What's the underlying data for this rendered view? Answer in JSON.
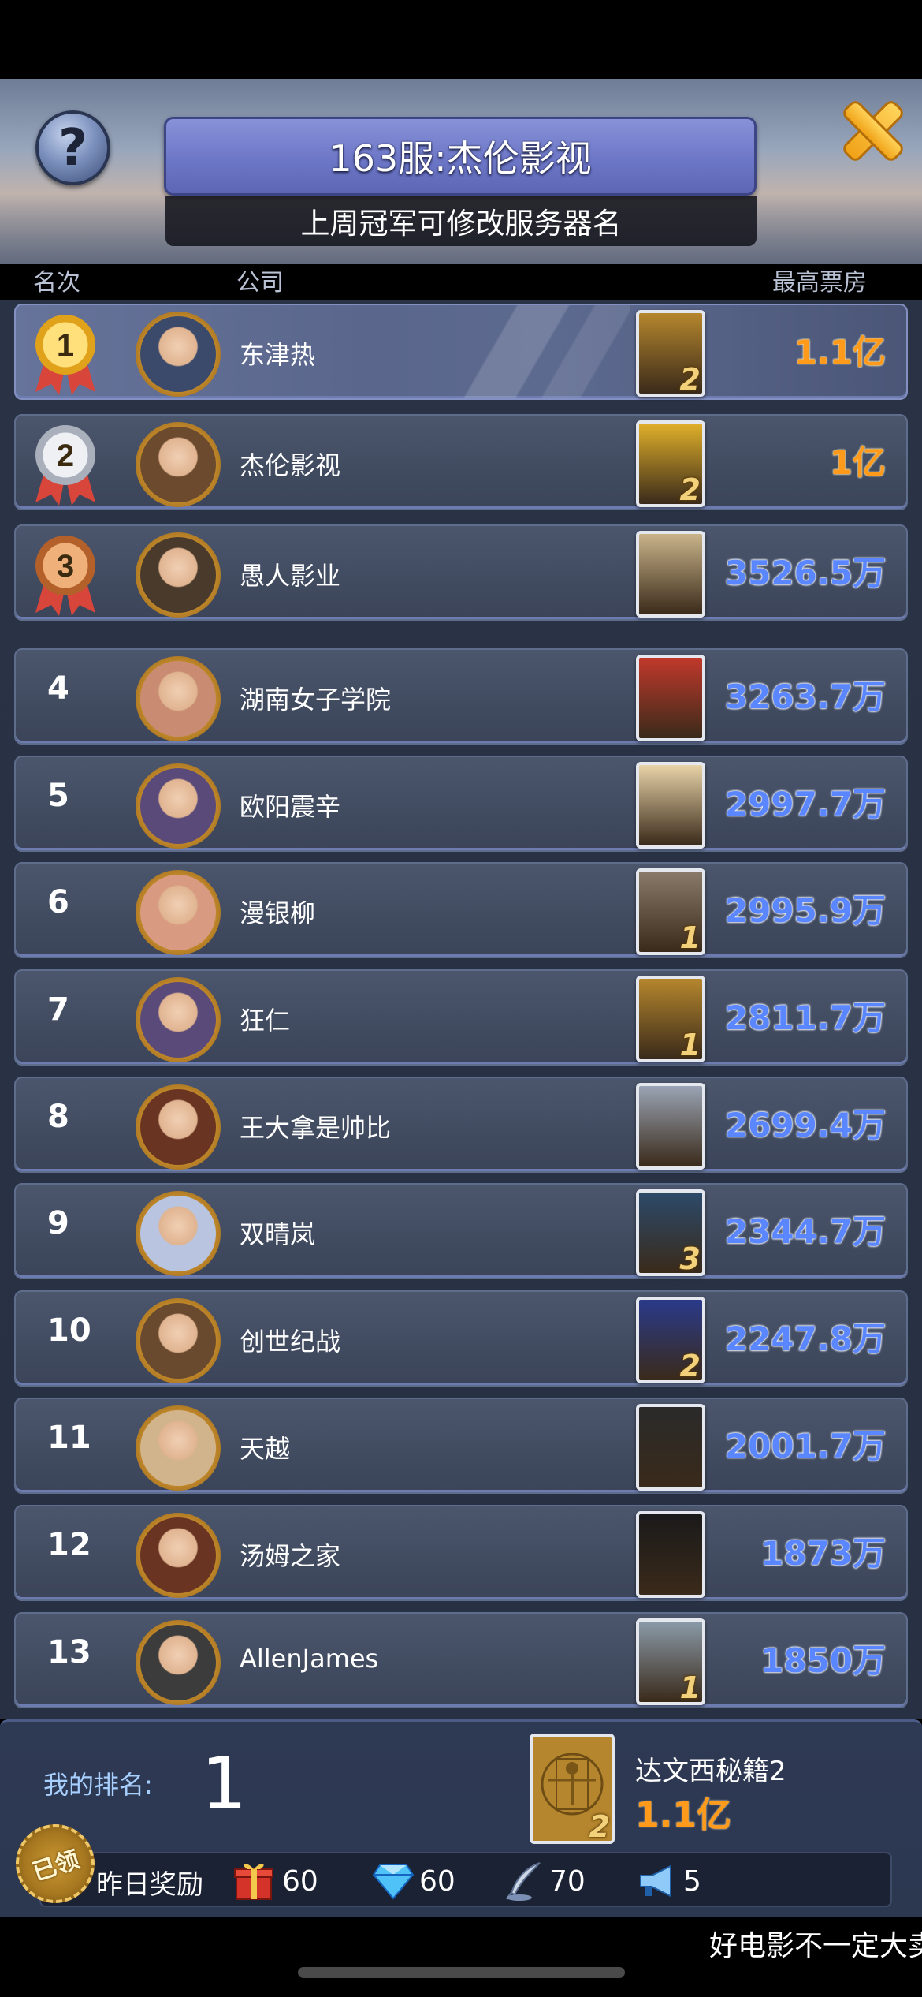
{
  "header": {
    "title": "163服:杰伦影视",
    "subtitle": "上周冠军可修改服务器名"
  },
  "columns": {
    "rank": "名次",
    "company": "公司",
    "top_box_office": "最高票房"
  },
  "rows": [
    {
      "rank": "1",
      "name": "东津热",
      "box_office": "1.1亿",
      "sequel": "2",
      "color": "#ff9a1a"
    },
    {
      "rank": "2",
      "name": "杰伦影视",
      "box_office": "1亿",
      "sequel": "2",
      "color": "#ff9a1a"
    },
    {
      "rank": "3",
      "name": "愚人影业",
      "box_office": "3526.5万",
      "sequel": "",
      "color": "#5a86ff"
    },
    {
      "rank": "4",
      "name": "湖南女子学院",
      "box_office": "3263.7万",
      "sequel": "",
      "color": "#5a86ff"
    },
    {
      "rank": "5",
      "name": "欧阳震辛",
      "box_office": "2997.7万",
      "sequel": "",
      "color": "#5a86ff"
    },
    {
      "rank": "6",
      "name": "漫银柳",
      "box_office": "2995.9万",
      "sequel": "1",
      "color": "#5a86ff"
    },
    {
      "rank": "7",
      "name": "狂仁",
      "box_office": "2811.7万",
      "sequel": "1",
      "color": "#5a86ff"
    },
    {
      "rank": "8",
      "name": "王大拿是帅比",
      "box_office": "2699.4万",
      "sequel": "",
      "color": "#5a86ff"
    },
    {
      "rank": "9",
      "name": "双晴岚",
      "box_office": "2344.7万",
      "sequel": "3",
      "color": "#5a86ff"
    },
    {
      "rank": "10",
      "name": "创世纪战",
      "box_office": "2247.8万",
      "sequel": "2",
      "color": "#5a86ff"
    },
    {
      "rank": "11",
      "name": "天越",
      "box_office": "2001.7万",
      "sequel": "",
      "color": "#5a86ff"
    },
    {
      "rank": "12",
      "name": "汤姆之家",
      "box_office": "1873万",
      "sequel": "",
      "color": "#5a86ff"
    },
    {
      "rank": "13",
      "name": "AllenJames",
      "box_office": "1850万",
      "sequel": "1",
      "color": "#5a86ff"
    }
  ],
  "my_rank": {
    "label": "我的排名:",
    "value": "1",
    "movie_title": "达文西秘籍2",
    "box_office": "1.1亿",
    "poster_sequel": "2"
  },
  "daily_reward": {
    "label": "昨日奖励",
    "claimed_stamp": "已领",
    "items": [
      {
        "icon": "gift-box-icon",
        "value": "60"
      },
      {
        "icon": "diamond-icon",
        "value": "60"
      },
      {
        "icon": "quill-pen-icon",
        "value": "70"
      },
      {
        "icon": "megaphone-icon",
        "value": "5"
      }
    ]
  },
  "ticker": {
    "text": "好电影不一定大卖"
  },
  "colors": {
    "accent_gold": "#ff9a1a",
    "accent_blue": "#5a86ff",
    "title_bar": "#6d77c7",
    "row_bg": "#454f66"
  }
}
